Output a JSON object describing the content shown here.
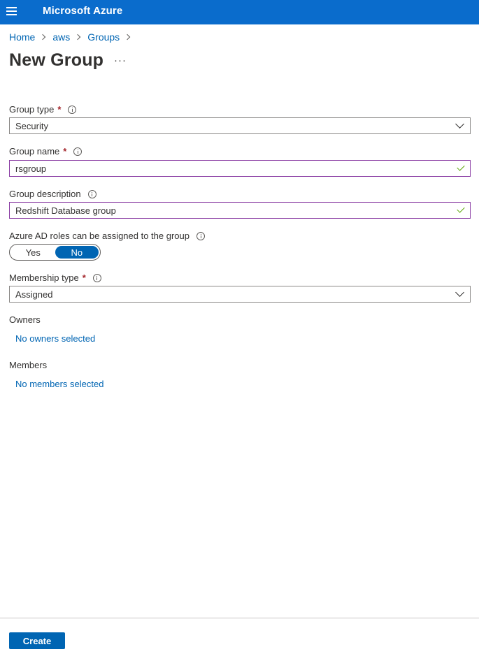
{
  "header": {
    "app_title": "Microsoft Azure",
    "menu_icon": "hamburger-icon"
  },
  "breadcrumb": [
    {
      "label": "Home"
    },
    {
      "label": "aws"
    },
    {
      "label": "Groups"
    }
  ],
  "page": {
    "title": "New Group",
    "more_label": "···"
  },
  "form": {
    "group_type": {
      "label": "Group type",
      "required": "*",
      "value": "Security"
    },
    "group_name": {
      "label": "Group name",
      "required": "*",
      "value": "rsgroup"
    },
    "group_description": {
      "label": "Group description",
      "value": "Redshift Database group"
    },
    "azure_ad_roles": {
      "label": "Azure AD roles can be assigned to the group",
      "options": [
        "Yes",
        "No"
      ],
      "selected": "No"
    },
    "membership_type": {
      "label": "Membership type",
      "required": "*",
      "value": "Assigned"
    },
    "owners": {
      "label": "Owners",
      "link": "No owners selected"
    },
    "members": {
      "label": "Members",
      "link": "No members selected"
    }
  },
  "footer": {
    "create_label": "Create"
  },
  "colors": {
    "accent": "#0065b3",
    "topbar": "#0a6ccc",
    "valid_check": "#57a300",
    "required": "#a4262c"
  }
}
